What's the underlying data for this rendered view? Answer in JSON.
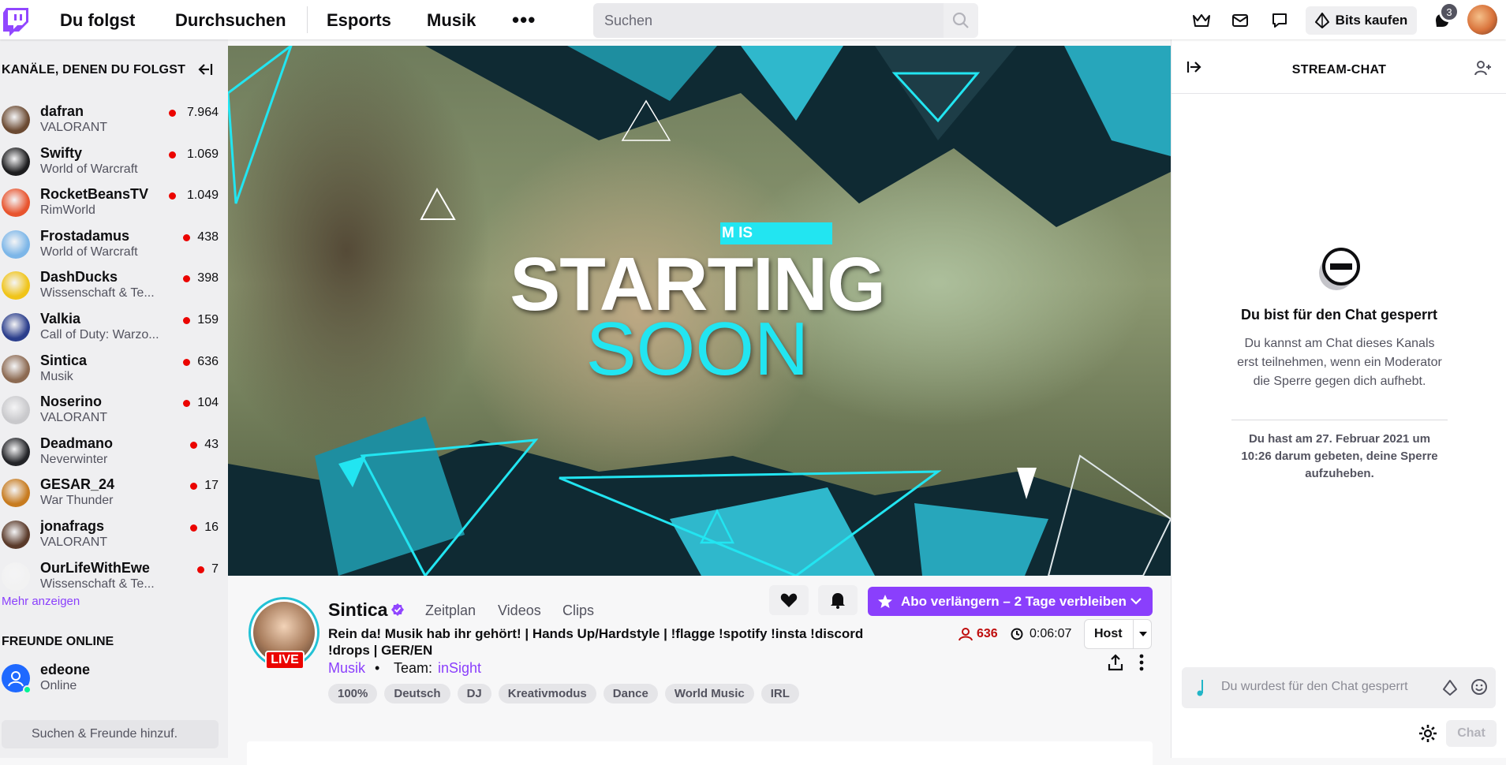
{
  "topnav": {
    "following": "Du folgst",
    "browse": "Durchsuchen",
    "esports": "Esports",
    "music": "Musik",
    "more": "•••",
    "search_placeholder": "Suchen",
    "bits_label": "Bits kaufen",
    "notification_count": "3"
  },
  "sidebar": {
    "header": "KANÄLE, DENEN DU FOLGST",
    "channels": [
      {
        "name": "dafran",
        "game": "VALORANT",
        "viewers": "7.964",
        "color": "#6b4a32"
      },
      {
        "name": "Swifty",
        "game": "World of Warcraft",
        "viewers": "1.069",
        "color": "#1d1d1f"
      },
      {
        "name": "RocketBeansTV",
        "game": "RimWorld",
        "viewers": "1.049",
        "color": "#e8542e"
      },
      {
        "name": "Frostadamus",
        "game": "World of Warcraft",
        "viewers": "438",
        "color": "#7cb6e8"
      },
      {
        "name": "DashDucks",
        "game": "Wissenschaft & Te...",
        "viewers": "398",
        "color": "#f0c419"
      },
      {
        "name": "Valkia",
        "game": "Call of Duty: Warzo...",
        "viewers": "159",
        "color": "#2b3e8c"
      },
      {
        "name": "Sintica",
        "game": "Musik",
        "viewers": "636",
        "color": "#8c6a52"
      },
      {
        "name": "Noserino",
        "game": "VALORANT",
        "viewers": "104",
        "color": "#c9c9cc"
      },
      {
        "name": "Deadmano",
        "game": "Neverwinter",
        "viewers": "43",
        "color": "#232428"
      },
      {
        "name": "GESAR_24",
        "game": "War Thunder",
        "viewers": "17",
        "color": "#c77b1f"
      },
      {
        "name": "jonafrags",
        "game": "VALORANT",
        "viewers": "16",
        "color": "#5a3a2a"
      },
      {
        "name": "OurLifeWithEwe",
        "game": "Wissenschaft & Te...",
        "viewers": "7",
        "color": "#f2f2f2"
      }
    ],
    "more": "Mehr anzeigen",
    "friends_header": "FREUNDE ONLINE",
    "friend": {
      "name": "edeone",
      "status": "Online"
    },
    "friend_search_placeholder": "Suchen & Freunde hinzuf."
  },
  "video": {
    "label": "M IS",
    "line1": "STARTING",
    "line2": "SOON"
  },
  "channel": {
    "name": "Sintica",
    "live": "LIVE",
    "tabs": [
      "Zeitplan",
      "Videos",
      "Clips"
    ],
    "title": "Rein da! Musik hab ihr gehört! | Hands Up/Hardstyle | !flagge !spotify !insta !discord !drops | GER/EN",
    "category": "Musik",
    "dot": "•",
    "team_label": "Team:",
    "team": "inSight",
    "tags": [
      "100%",
      "Deutsch",
      "DJ",
      "Kreativmodus",
      "Dance",
      "World Music",
      "IRL"
    ],
    "subscribe": "Abo verlängern – 2 Tage verbleiben",
    "viewers": "636",
    "uptime": "0:06:07",
    "host": "Host"
  },
  "chat": {
    "title": "STREAM-CHAT",
    "ban_title": "Du bist für den Chat gesperrt",
    "ban_desc": "Du kannst am Chat dieses Kanals erst teilnehmen, wenn ein Moderator die Sperre gegen dich aufhebt.",
    "ban_request": "Du hast am 27. Februar 2021 um 10:26 darum gebeten, deine Sperre aufzuheben.",
    "input_placeholder": "Du wurdest für den Chat gesperrt",
    "send": "Chat"
  },
  "colors": {
    "brand": "#9146ff",
    "live": "#eb0400",
    "accent_cyan": "#22e5f1"
  }
}
